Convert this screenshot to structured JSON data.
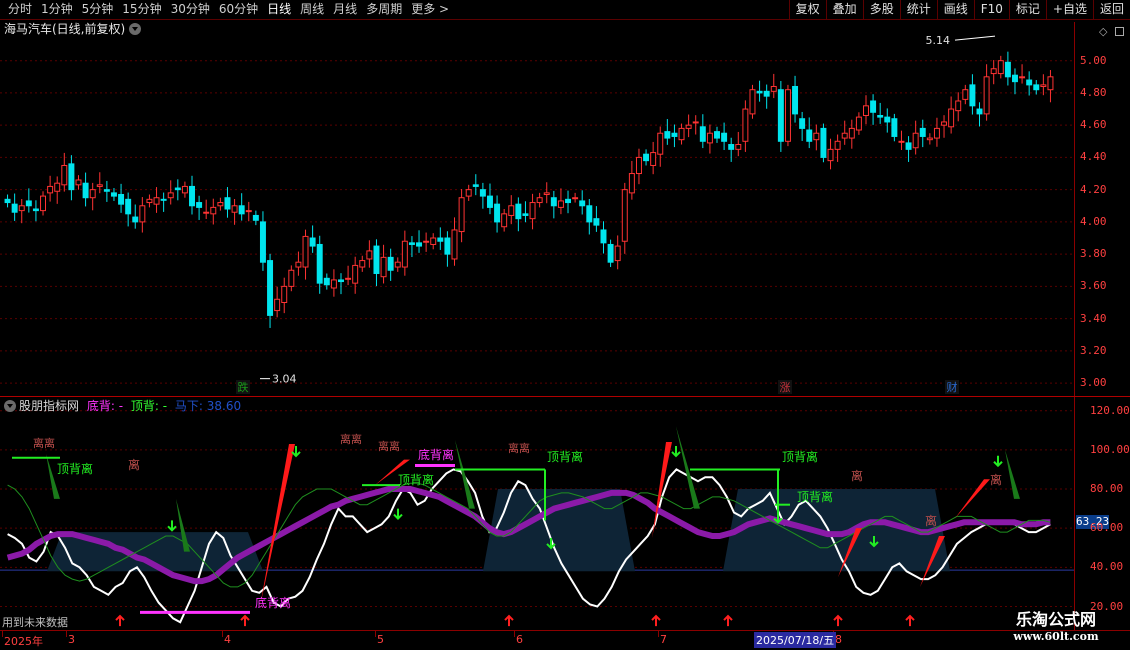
{
  "toolbar": {
    "periods": [
      "分时",
      "1分钟",
      "5分钟",
      "15分钟",
      "30分钟",
      "60分钟",
      "日线",
      "周线",
      "月线",
      "多周期",
      "更多 >"
    ],
    "active_period": "日线",
    "buttons": [
      "复权",
      "叠加",
      "多股",
      "统计",
      "画线",
      "F10",
      "标记",
      "+自选",
      "返回"
    ]
  },
  "main_panel": {
    "title": "海马汽车(日线,前复权)",
    "high_marker": "5.14",
    "low_marker": "3.04",
    "event_markers": [
      "跌",
      "涨",
      "财"
    ],
    "colors": {
      "up": "#ff3333",
      "down": "#00e5ee"
    }
  },
  "sub_panel": {
    "name": "股朋指标网",
    "bottom_div_label": "底背: -",
    "top_div_label": "顶背: -",
    "extra_label": "马下: 38.60",
    "current_value": "63.23",
    "divergence_labels": {
      "top": "顶背离",
      "bottom": "底背离",
      "leave": "离"
    },
    "future_note": "用到未来数据"
  },
  "date_axis": {
    "labels": [
      "2025年",
      "3",
      "4",
      "5",
      "6",
      "7",
      "8"
    ],
    "cursor_date": "2025/07/18/五"
  },
  "watermark": {
    "line1": "乐淘公式网",
    "line2": "www.60lt.com"
  },
  "chart_data": [
    {
      "type": "candlestick",
      "title": "海马汽车(日线,前复权)",
      "ylim": [
        2.92,
        5.24
      ],
      "yticks": [
        3.0,
        3.2,
        3.4,
        3.6,
        3.8,
        4.0,
        4.2,
        4.4,
        4.6,
        4.8,
        5.0
      ],
      "high_label": 5.14,
      "low_label": 3.04,
      "close": [
        4.12,
        4.06,
        4.1,
        4.1,
        4.07,
        4.16,
        4.22,
        4.24,
        4.35,
        4.2,
        4.26,
        4.15,
        4.2,
        4.23,
        4.19,
        4.16,
        4.11,
        4.05,
        4.0,
        4.1,
        4.14,
        4.15,
        4.14,
        4.18,
        4.2,
        4.22,
        4.1,
        4.09,
        4.06,
        4.09,
        4.12,
        4.08,
        4.1,
        4.05,
        4.07,
        4.01,
        3.75,
        3.42,
        3.52,
        3.6,
        3.7,
        3.75,
        3.91,
        3.85,
        3.62,
        3.61,
        3.64,
        3.63,
        3.65,
        3.73,
        3.76,
        3.82,
        3.68,
        3.78,
        3.7,
        3.75,
        3.88,
        3.86,
        3.85,
        3.88,
        3.9,
        3.88,
        3.8,
        3.95,
        4.15,
        4.2,
        4.22,
        4.16,
        4.09,
        4.0,
        4.05,
        4.1,
        4.02,
        4.04,
        4.12,
        4.15,
        4.18,
        4.1,
        4.13,
        4.12,
        4.15,
        4.1,
        4.0,
        3.98,
        3.87,
        3.75,
        3.85,
        4.2,
        4.3,
        4.4,
        4.38,
        4.43,
        4.55,
        4.52,
        4.53,
        4.58,
        4.6,
        4.62,
        4.5,
        4.55,
        4.52,
        4.5,
        4.45,
        4.48,
        4.7,
        4.82,
        4.8,
        4.78,
        4.84,
        4.5,
        4.82,
        4.67,
        4.58,
        4.5,
        4.55,
        4.4,
        4.45,
        4.5,
        4.55,
        4.58,
        4.65,
        4.72,
        4.68,
        4.65,
        4.62,
        4.53,
        4.5,
        4.45,
        4.55,
        4.53,
        4.52,
        4.58,
        4.62,
        4.7,
        4.75,
        4.82,
        4.72,
        4.67,
        4.9,
        4.95,
        5.0,
        4.9,
        4.87,
        4.9,
        4.85,
        4.82,
        4.85,
        4.9
      ],
      "up_color": "#ff3333",
      "down_color": "#00e5ee"
    },
    {
      "type": "line",
      "title": "股朋指标网",
      "ylim": [
        8,
        127
      ],
      "yticks": [
        20.0,
        40.0,
        60.0,
        80.0,
        100.0,
        120.0
      ],
      "reference_lines": [
        38.6
      ],
      "series": [
        {
          "name": "",
          "color": "#ffffff",
          "values": [
            57,
            55,
            52,
            45,
            43,
            48,
            58,
            56,
            50,
            42,
            40,
            36,
            30,
            28,
            26,
            30,
            32,
            38,
            40,
            35,
            28,
            22,
            18,
            14,
            12,
            20,
            28,
            40,
            52,
            58,
            55,
            46,
            40,
            34,
            28,
            27,
            30,
            22,
            20,
            24,
            25,
            28,
            35,
            44,
            52,
            62,
            70,
            66,
            66,
            62,
            58,
            60,
            62,
            66,
            74,
            80,
            78,
            72,
            74,
            80,
            84,
            88,
            90,
            89,
            84,
            78,
            66,
            58,
            60,
            68,
            78,
            84,
            82,
            75,
            70,
            60,
            50,
            42,
            36,
            30,
            24,
            21,
            20,
            24,
            30,
            38,
            44,
            48,
            52,
            56,
            62,
            76,
            86,
            90,
            88,
            86,
            84,
            86,
            86,
            82,
            76,
            68,
            66,
            70,
            72,
            74,
            78,
            70,
            62,
            66,
            72,
            74,
            70,
            66,
            60,
            52,
            44,
            38,
            30,
            27,
            26,
            28,
            34,
            40,
            42,
            38,
            36,
            34,
            34,
            36,
            40,
            46,
            52,
            55,
            58,
            60,
            62,
            63,
            63,
            63,
            62,
            60,
            58,
            58,
            60,
            62
          ]
        },
        {
          "name": "",
          "color": "#8b1aa8",
          "values": [
            45,
            46,
            47,
            49,
            52,
            54,
            56,
            57,
            57,
            57,
            56,
            55,
            54,
            53,
            52,
            50,
            49,
            47,
            45,
            44,
            42,
            40,
            38,
            36,
            35,
            34,
            33,
            33,
            34,
            36,
            39,
            42,
            45,
            47,
            49,
            51,
            53,
            55,
            57,
            59,
            61,
            63,
            65,
            67,
            69,
            71,
            72,
            74,
            75,
            76,
            77,
            78,
            79,
            80,
            80,
            80,
            80,
            79,
            78,
            77,
            76,
            74,
            72,
            70,
            68,
            66,
            63,
            60,
            58,
            57,
            58,
            60,
            62,
            64,
            66,
            68,
            70,
            71,
            72,
            73,
            74,
            75,
            76,
            77,
            78,
            78,
            78,
            77,
            75,
            73,
            70,
            68,
            66,
            64,
            62,
            60,
            58,
            57,
            56,
            56,
            57,
            58,
            60,
            62,
            63,
            64,
            65,
            64,
            63,
            62,
            61,
            60,
            59,
            58,
            57,
            57,
            57,
            58,
            60,
            62,
            63,
            63,
            63,
            62,
            61,
            60,
            59,
            58,
            58,
            59,
            60,
            61,
            62,
            63,
            63,
            63,
            63,
            63,
            63,
            63,
            63,
            62,
            62,
            62,
            63,
            63
          ]
        },
        {
          "name": "",
          "color": "#1f8f1f",
          "values": [
            82,
            80,
            76,
            70,
            62,
            54,
            46,
            40,
            36,
            34,
            33,
            34,
            36,
            38,
            40,
            42,
            44,
            46,
            48,
            50,
            52,
            54,
            56,
            56,
            54,
            52,
            48,
            44,
            40,
            36,
            32,
            30,
            30,
            32,
            36,
            42,
            48,
            54,
            60,
            66,
            72,
            76,
            78,
            80,
            80,
            80,
            78,
            76,
            74,
            72,
            72,
            74,
            76,
            78,
            80,
            82,
            83,
            83,
            82,
            80,
            78,
            76,
            74,
            72,
            70,
            66,
            62,
            58,
            56,
            56,
            58,
            62,
            66,
            70,
            74,
            76,
            77,
            78,
            78,
            77,
            76,
            74,
            72,
            70,
            70,
            72,
            74,
            76,
            78,
            78,
            77,
            76,
            74,
            72,
            70,
            70,
            72,
            74,
            76,
            76,
            75,
            74,
            72,
            70,
            68,
            66,
            64,
            62,
            60,
            58,
            56,
            54,
            52,
            50,
            50,
            52,
            54,
            56,
            58,
            60,
            62,
            64,
            66,
            66,
            64,
            62,
            60,
            58,
            58,
            60,
            62,
            64,
            66,
            66,
            66,
            64,
            62,
            60,
            58,
            58,
            60,
            62,
            64,
            64,
            64,
            63
          ]
        }
      ]
    }
  ]
}
